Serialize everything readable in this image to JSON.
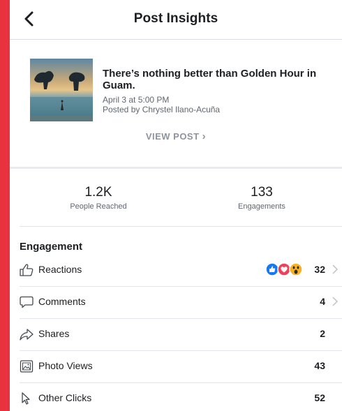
{
  "header": {
    "title": "Post Insights"
  },
  "post": {
    "title": "There’s nothing better than Golden Hour in Guam.",
    "date": "April 3 at 5:00 PM",
    "posted_by": "Posted by Chrystel Ilano-Acuña",
    "view_post_label": "VIEW POST",
    "view_post_chevron": "›"
  },
  "stats": {
    "reached_value": "1.2K",
    "reached_label": "People Reached",
    "engagements_value": "133",
    "engagements_label": "Engagements"
  },
  "engagement": {
    "heading": "Engagement",
    "rows": [
      {
        "label": "Reactions",
        "value": "32",
        "icon": "thumbs-up-icon"
      },
      {
        "label": "Comments",
        "value": "4",
        "icon": "comment-icon"
      },
      {
        "label": "Shares",
        "value": "2",
        "icon": "share-icon"
      },
      {
        "label": "Photo Views",
        "value": "43",
        "icon": "photo-icon"
      },
      {
        "label": "Other Clicks",
        "value": "52",
        "icon": "cursor-icon"
      }
    ],
    "reaction_icons": [
      "like-reaction-icon",
      "love-reaction-icon",
      "wow-reaction-icon"
    ]
  },
  "colors": {
    "frame": "#e8323f",
    "like_blue": "#1877f2",
    "love_red": "#f33e58",
    "wow_yellow": "#f7b125"
  }
}
